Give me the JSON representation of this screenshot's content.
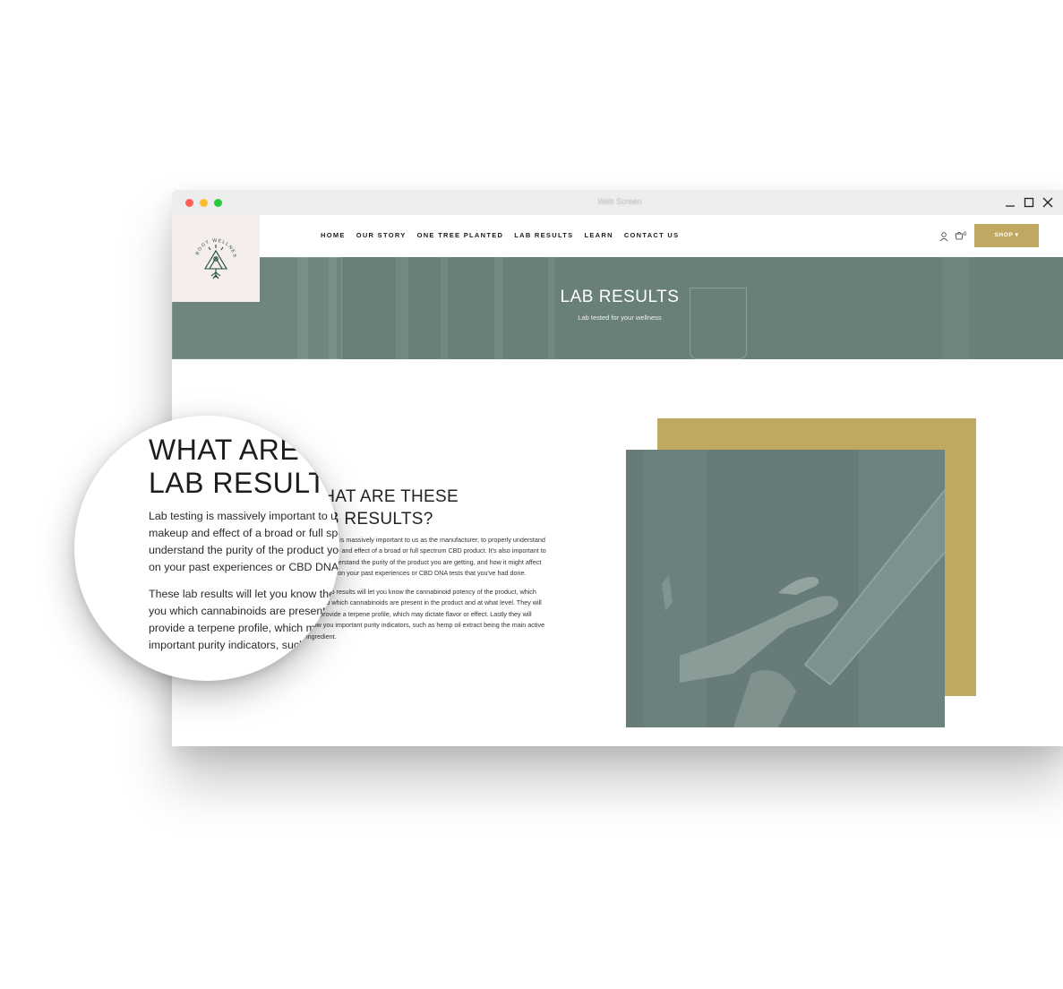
{
  "window": {
    "title": "Web Screen"
  },
  "logo": {
    "text": "ROOT WELLNESS"
  },
  "nav": {
    "items": [
      {
        "label": "HOME"
      },
      {
        "label": "OUR STORY"
      },
      {
        "label": "ONE TREE PLANTED"
      },
      {
        "label": "LAB RESULTS"
      },
      {
        "label": "LEARN"
      },
      {
        "label": "CONTACT US"
      }
    ],
    "cart_count": "0",
    "shop_label": "SHOP ▾"
  },
  "hero": {
    "title": "LAB RESULTS",
    "subtitle": "Lab tested for your wellness"
  },
  "content": {
    "heading_line1": "WHAT ARE THESE",
    "heading_line2": "LAB RESULTS?",
    "para1": "Lab testing is massively important to us as the manufacturer, to properly understand the makeup and effect of a broad or full spectrum CBD product. It's also important to you, to understand the purity of the product you are getting, and how it might affect you based on your past experiences or CBD DNA tests that you've had done.",
    "para2": "These lab results will let you know the cannabinoid potency of the product, which tells you which cannabinoids are present in the product and at what level. They will also provide a terpene profile, which may dictate flavor or effect. Lastly they will show you important purity indicators, such as hemp oil extract being the main active ingredient."
  },
  "magnifier": {
    "heading_line1": "WHAT ARE T",
    "heading_line2": "LAB RESULTS",
    "para1_lines": [
      "Lab testing is massively important to us a",
      "makeup and effect of a broad or full spect",
      "understand the purity of the product you a",
      "on your past experiences or CBD DNA tests"
    ],
    "para2_lines": [
      "These lab results will let you know the c",
      "you which cannabinoids are present in",
      "provide a terpene profile, which ma",
      "important purity indicators, such"
    ]
  },
  "colors": {
    "accent_gold": "#c1a862",
    "hero_teal": "#687f7a",
    "logo_bg": "#f5eeea",
    "logo_green": "#1f4a3c"
  }
}
